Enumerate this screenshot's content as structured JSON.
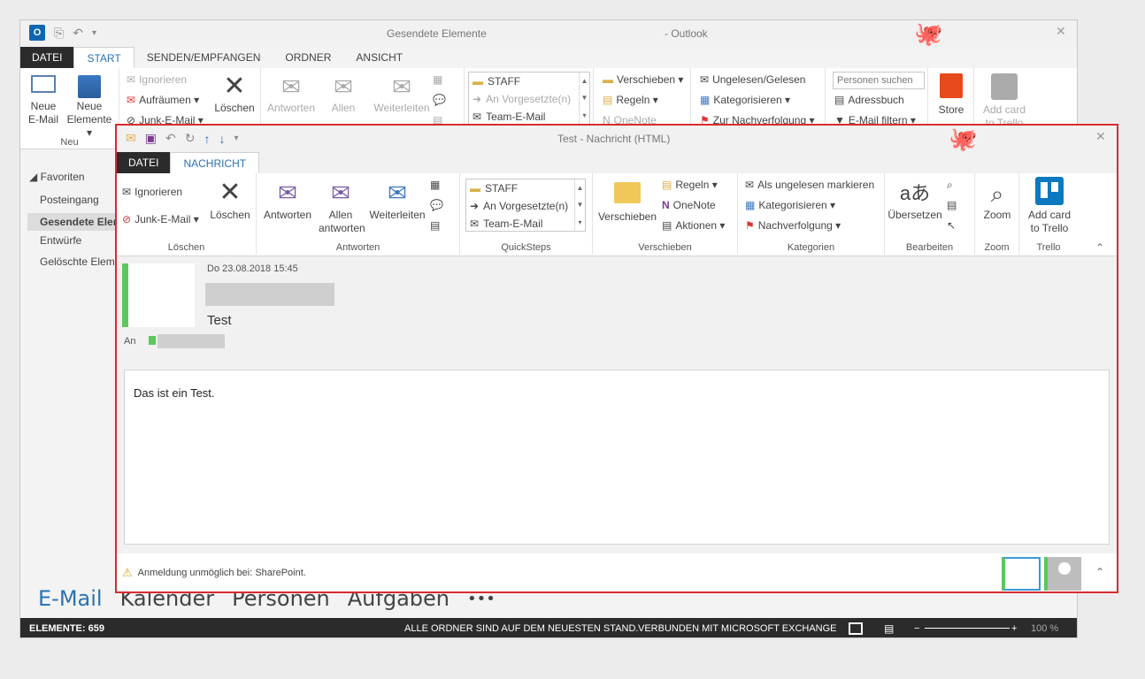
{
  "main_window": {
    "title": "Gesendete Elemente",
    "app_name": "- Outlook",
    "tabs": [
      {
        "label": "DATEI"
      },
      {
        "label": "START"
      },
      {
        "label": "SENDEN/EMPFANGEN"
      },
      {
        "label": "ORDNER"
      },
      {
        "label": "ANSICHT"
      }
    ],
    "ribbon": {
      "neu_email": "Neue\nE-Mail",
      "neu_elemente": "Neue\nElemente ▾",
      "neu_group": "Neu",
      "ignorieren": "Ignorieren",
      "aufraeumen": "Aufräumen ▾",
      "junk": "Junk-E-Mail ▾",
      "loeschen": "Löschen",
      "antworten": "Antworten",
      "allen": "Allen",
      "weiterleiten": "Weiterleiten",
      "qs": [
        "STAFF",
        "An Vorgesetzte(n)",
        "Team-E-Mail"
      ],
      "verschieben": "Verschieben ▾",
      "regeln": "Regeln ▾",
      "onenote": "OneNote",
      "ungelesen": "Ungelesen/Gelesen",
      "kategorisieren": "Kategorisieren ▾",
      "nachverfolgung": "Zur Nachverfolgung ▾",
      "personen_placeholder": "Personen suchen",
      "adressbuch": "Adressbuch",
      "email_filtern": "E-Mail filtern ▾",
      "store": "Store",
      "add_card": "Add card\nto Trello"
    },
    "nav": {
      "favoriten": "Favoriten",
      "items": [
        "Posteingang",
        "Gesendete Elem",
        "Entwürfe",
        "Gelöschte Eleme"
      ]
    },
    "bottom_nav": [
      "E-Mail",
      "Kalender",
      "Personen",
      "Aufgaben",
      "•••"
    ],
    "status": {
      "elemente": "ELEMENTE: 659",
      "ordner": "ALLE ORDNER SIND AUF DEM NEUESTEN STAND.",
      "verbunden": "VERBUNDEN MIT MICROSOFT EXCHANGE",
      "zoom": "100 %"
    }
  },
  "message_window": {
    "title": "Test - Nachricht (HTML)",
    "tabs": [
      {
        "label": "DATEI"
      },
      {
        "label": "NACHRICHT"
      }
    ],
    "ribbon": {
      "ignorieren": "Ignorieren",
      "junk": "Junk-E-Mail ▾",
      "loeschen": "Löschen",
      "group_loeschen": "Löschen",
      "antworten": "Antworten",
      "allen": "Allen\nantworten",
      "weiterleiten": "Weiterleiten",
      "group_antworten": "Antworten",
      "qs": [
        "STAFF",
        "An Vorgesetzte(n)",
        "Team-E-Mail"
      ],
      "group_quicksteps": "QuickSteps",
      "verschieben": "Verschieben",
      "regeln": "Regeln ▾",
      "onenote": "OneNote",
      "aktionen": "Aktionen ▾",
      "group_verschieben": "Verschieben",
      "als_ungelesen": "Als ungelesen markieren",
      "kategorisieren": "Kategorisieren ▾",
      "nachverfolgung": "Nachverfolgung ▾",
      "group_kategorien": "Kategorien",
      "uebersetzen": "Übersetzen",
      "group_bearbeiten": "Bearbeiten",
      "zoom": "Zoom",
      "group_zoom": "Zoom",
      "add_card": "Add card\nto Trello",
      "group_trello": "Trello"
    },
    "header": {
      "date": "Do 23.08.2018 15:45",
      "subject": "Test",
      "to_label": "An"
    },
    "body": "Das ist ein Test.",
    "status_warning": "Anmeldung unmöglich bei: SharePoint."
  },
  "colors": {
    "accent": "#2a72b5",
    "highlight_border": "#d92b2b",
    "presence_green": "#5cc85c",
    "status_bar": "#2b2b2b"
  }
}
